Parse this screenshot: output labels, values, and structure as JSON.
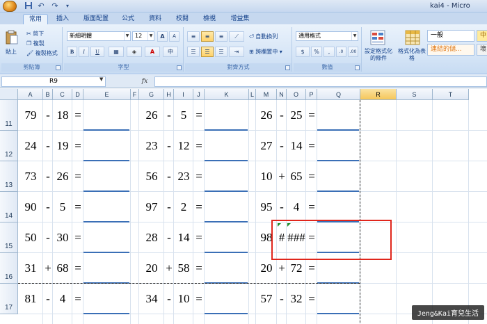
{
  "window": {
    "title": "kai4 - Micro"
  },
  "tabs": [
    {
      "label": "常用",
      "active": true
    },
    {
      "label": "插入",
      "active": false
    },
    {
      "label": "版面配置",
      "active": false
    },
    {
      "label": "公式",
      "active": false
    },
    {
      "label": "資料",
      "active": false
    },
    {
      "label": "校閱",
      "active": false
    },
    {
      "label": "檢視",
      "active": false
    },
    {
      "label": "增益集",
      "active": false
    }
  ],
  "ribbon": {
    "clipboard": {
      "paste": "貼上",
      "cut": "剪下",
      "copy": "複製",
      "format_painter": "複製格式",
      "label": "剪貼簿"
    },
    "font": {
      "name": "新細明體",
      "size": "12",
      "bold": "B",
      "italic": "I",
      "underline": "U",
      "grow": "A",
      "shrink": "A",
      "label": "字型"
    },
    "alignment": {
      "wrap": "自動換列",
      "merge": "跨欄置中",
      "label": "對齊方式"
    },
    "number": {
      "format": "通用格式",
      "currency": "$",
      "percent": "%",
      "comma": ",",
      "label": "數值"
    },
    "styles": {
      "conditional": "設定格式化的條件",
      "as_table": "格式化為表格",
      "normal": "一般",
      "link": "連結的儲...",
      "mid": "中",
      "bad": "壞"
    }
  },
  "formula_bar": {
    "name_box": "R9",
    "fx": "fx"
  },
  "grid": {
    "columns": [
      "A",
      "B",
      "C",
      "D",
      "E",
      "F",
      "G",
      "H",
      "I",
      "J",
      "K",
      "L",
      "M",
      "N",
      "O",
      "P",
      "Q",
      "R",
      "S",
      "T"
    ],
    "selected_column": "R",
    "rows": [
      {
        "num": "11",
        "a": "79",
        "op1": "-",
        "b": "18",
        "g": "26",
        "op2": "-",
        "h": "5",
        "m": "26",
        "op3": "-",
        "n": "25"
      },
      {
        "num": "12",
        "a": "24",
        "op1": "-",
        "b": "19",
        "g": "23",
        "op2": "-",
        "h": "12",
        "m": "27",
        "op3": "-",
        "n": "14"
      },
      {
        "num": "13",
        "a": "73",
        "op1": "-",
        "b": "26",
        "g": "56",
        "op2": "-",
        "h": "23",
        "m": "10",
        "op3": "+",
        "n": "65"
      },
      {
        "num": "14",
        "a": "90",
        "op1": "-",
        "b": "5",
        "g": "97",
        "op2": "-",
        "h": "2",
        "m": "95",
        "op3": "-",
        "n": "4"
      },
      {
        "num": "15",
        "a": "50",
        "op1": "-",
        "b": "30",
        "g": "28",
        "op2": "-",
        "h": "14",
        "m": "98",
        "op3": "#",
        "n": "###"
      },
      {
        "num": "16",
        "a": "31",
        "op1": "+",
        "b": "68",
        "g": "20",
        "op2": "+",
        "h": "58",
        "m": "20",
        "op3": "+",
        "n": "72"
      },
      {
        "num": "17",
        "a": "81",
        "op1": "-",
        "b": "4",
        "g": "34",
        "op2": "-",
        "h": "10",
        "m": "57",
        "op3": "-",
        "n": "32"
      }
    ],
    "equals": "="
  },
  "watermark": "Jeng&Kai育兒生活"
}
